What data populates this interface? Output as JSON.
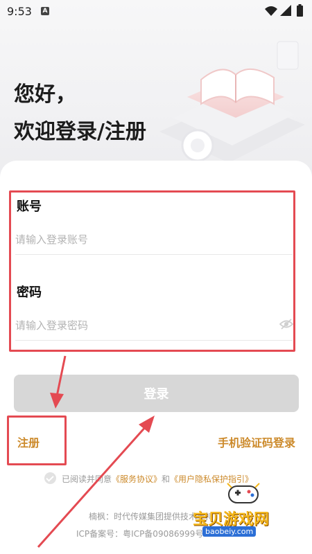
{
  "status": {
    "time": "9:53",
    "indicator": "A"
  },
  "greeting": {
    "line1": "您好，",
    "line2": "欢迎登录/注册"
  },
  "form": {
    "account_label": "账号",
    "account_placeholder": "请输入登录账号",
    "password_label": "密码",
    "password_placeholder": "请输入登录密码"
  },
  "actions": {
    "login_label": "登录",
    "register_label": "注册",
    "sms_login_label": "手机验证码登录"
  },
  "agreement": {
    "prefix": "已阅读并同意",
    "service_link": "《服务协议》",
    "and": "和",
    "privacy_link": "《用户隐私保护指引》"
  },
  "footer": {
    "provider": "楠枫：时代传媒集团提供技术支持",
    "icp": "ICP备案号：粤ICP备09086999号"
  },
  "watermark": {
    "title": "宝贝游戏网",
    "url": "baobeiy.com"
  },
  "colors": {
    "accent": "#cc8a2b",
    "annotation": "#e44a52",
    "button_disabled": "#d7d7d7"
  }
}
